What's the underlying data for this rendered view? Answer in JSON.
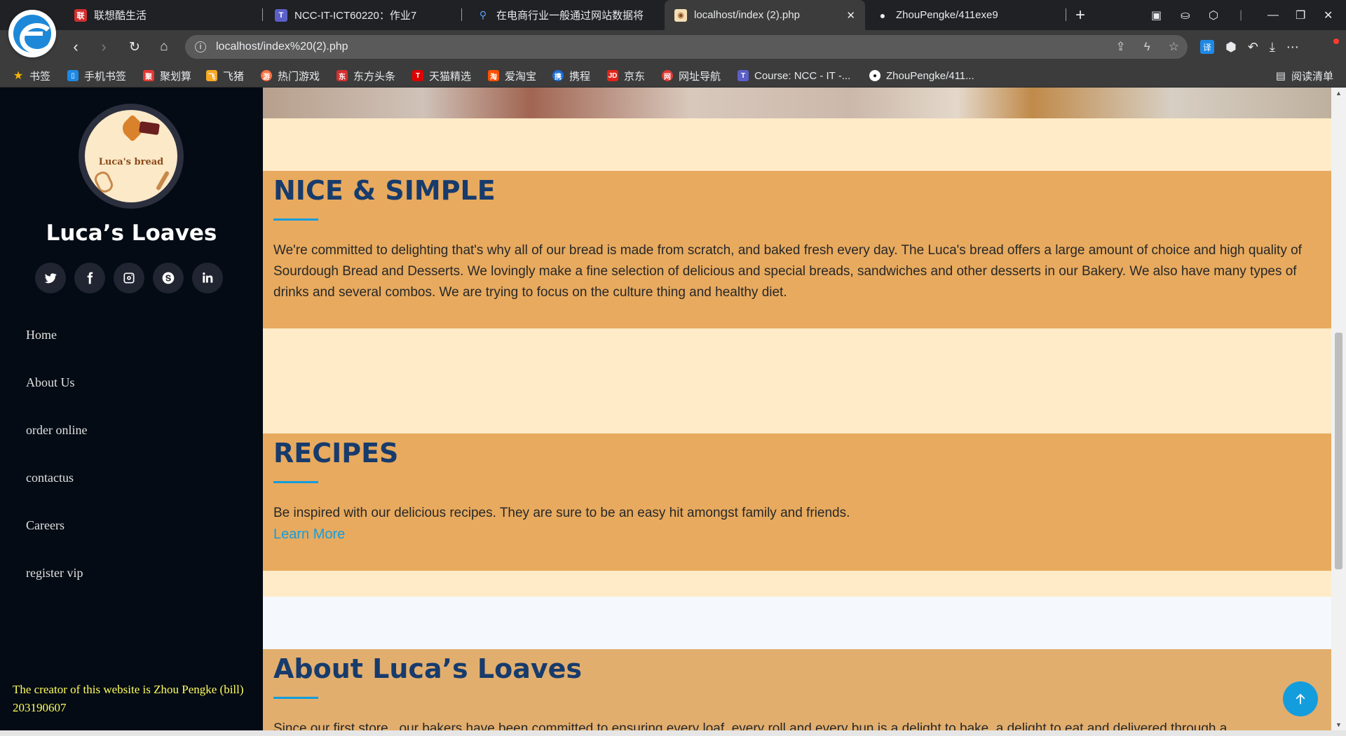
{
  "browser": {
    "tabs": [
      {
        "label": "联想酷生活",
        "favicon": "联",
        "favicon_color": "#d32f2f"
      },
      {
        "label": "NCC-IT-ICT60220：作业7",
        "favicon": "T",
        "favicon_color": "#5b5fc7"
      },
      {
        "label": "在电商行业一般通过网站数据将",
        "favicon": "🔍",
        "favicon_color": "#3c3c3c"
      },
      {
        "label": "localhost/index (2).php",
        "favicon": "🍞",
        "favicon_color": "#f5deb3",
        "active": true
      },
      {
        "label": "ZhouPengke/411exe9",
        "favicon": "●",
        "favicon_color": "#202124"
      }
    ],
    "url": "localhost/index%20(2).php",
    "bookmarks": [
      {
        "label": "书签",
        "icon": "star-icon",
        "color": "#f4b400"
      },
      {
        "label": "手机书签",
        "icon": "phone-icon",
        "color": "#1e88e5"
      },
      {
        "label": "聚划算",
        "icon": "聚",
        "color": "#e53935"
      },
      {
        "label": "飞猪",
        "icon": "飞",
        "color": "#f9a825"
      },
      {
        "label": "热门游戏",
        "icon": "游",
        "color": "#ff7043"
      },
      {
        "label": "东方头条",
        "icon": "东",
        "color": "#d32f2f"
      },
      {
        "label": "天猫精选",
        "icon": "T",
        "color": "#e00000"
      },
      {
        "label": "爱淘宝",
        "icon": "淘",
        "color": "#ff5000"
      },
      {
        "label": "携程",
        "icon": "携",
        "color": "#1e6fd9"
      },
      {
        "label": "京东",
        "icon": "JD",
        "color": "#e1251b"
      },
      {
        "label": "网址导航",
        "icon": "网",
        "color": "#e53935"
      },
      {
        "label": "Course: NCC - IT -...",
        "icon": "T",
        "color": "#5b5fc7"
      },
      {
        "label": "ZhouPengke/411...",
        "icon": "gh",
        "color": "#ffffff"
      }
    ],
    "reading_list": "阅读清单"
  },
  "sidebar": {
    "site_name": "Luca’s Loaves",
    "logo_text": "Luca's bread",
    "socials": [
      "twitter-icon",
      "facebook-icon",
      "instagram-icon",
      "skype-icon",
      "linkedin-icon"
    ],
    "nav": [
      "Home",
      "About Us",
      "order online",
      "contactus",
      "Careers",
      "register vip"
    ],
    "creator": "The creator of this website is Zhou Pengke (bill) 203190607"
  },
  "main": {
    "sections": [
      {
        "title": "NICE & SIMPLE",
        "text": "We're committed to delighting that's why all of our bread is made from scratch, and baked fresh every day. The Luca's bread offers a large amount of choice and high quality of Sourdough Bread and Desserts. We lovingly make a fine selection of delicious and special breads, sandwiches and other desserts in our Bakery. We also have many types of drinks and several combos. We are trying to focus on the culture thing and healthy diet."
      },
      {
        "title": "RECIPES",
        "text": "Be inspired with our delicious recipes. They are sure to be an easy hit amongst family and friends.",
        "link": "Learn More"
      },
      {
        "title": "About Luca’s Loaves",
        "text": "Since our first store , our bakers have been committed to ensuring every loaf, every roll and every bun is a delight to bake, a delight to eat and delivered through a"
      }
    ]
  },
  "colors": {
    "sidebar_bg": "#040b14",
    "section_bg": "#e8aa5e",
    "page_bg": "#ffebc8",
    "accent": "#149ddd",
    "title_color": "#173b6c",
    "creator_text": "#ffff5c"
  }
}
